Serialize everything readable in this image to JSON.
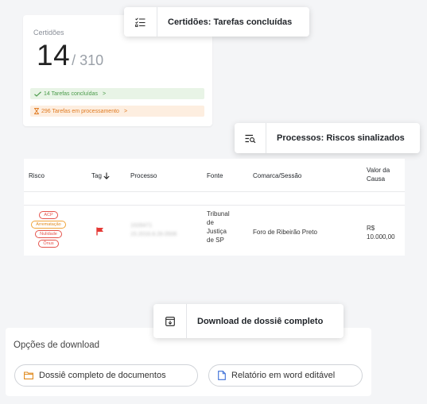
{
  "certidoes": {
    "label": "Certidões",
    "done": "14",
    "total": "/ 310",
    "concluidas": "14 Tarefas concluídas",
    "processamento": "296 Tarefas em processamento",
    "chevron": ">"
  },
  "chips": {
    "certidoes": "Certidões: Tarefas concluídas",
    "processos": "Processos: Riscos sinalizados",
    "download": "Download de dossiê completo"
  },
  "table": {
    "headers": {
      "risco": "Risco",
      "tag": "Tag",
      "processo": "Processo",
      "fonte": "Fonte",
      "comarca": "Comarca/Sessão",
      "valor_line1": "Valor da",
      "valor_line2": "Causa"
    },
    "row": {
      "risks": [
        "ACP",
        "Arrematação",
        "Nulidade",
        "Ônus"
      ],
      "processo_line1": "1028471",
      "processo_line2": "15.2016.8.26.0506",
      "fonte_lines": [
        "Tribunal",
        "de",
        "Justiça",
        "de SP"
      ],
      "comarca": "Foro de Ribeirão Preto",
      "valor_line1": "R$",
      "valor_line2": "10.000,00"
    }
  },
  "download": {
    "title": "Opções de download",
    "btn_dossie": "Dossiê completo de documentos",
    "btn_relatorio": "Relatório em word editável"
  },
  "colors": {
    "accent_orange": "#e08a1e",
    "flag_red": "#e53935",
    "doc_blue": "#3b6fd8",
    "green": "#4a9b4a"
  }
}
